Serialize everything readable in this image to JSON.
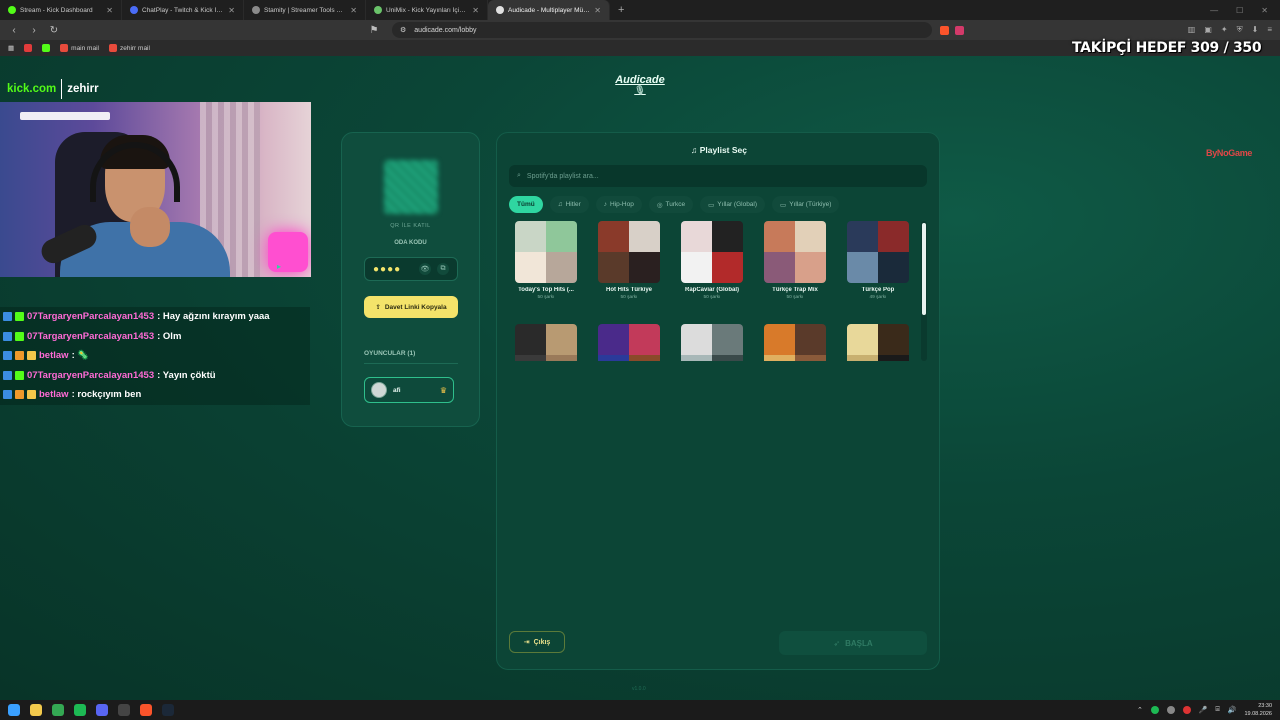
{
  "browser": {
    "tabs": [
      {
        "title": "Stream - Kick Dashboard",
        "color": "#53fc18"
      },
      {
        "title": "ChatPlay - Twitch & Kick İzleyici Etkil",
        "color": "#4a6cf7"
      },
      {
        "title": "Stamity | Streamer Tools & Party Gam",
        "color": "#8a8a8a"
      },
      {
        "title": "UniMix - Kick Yayınları İçin Kelime Ba",
        "color": "#6ac36a"
      },
      {
        "title": "Audicade - Multiplayer Müzik Ta",
        "color": "#e1e1e1"
      }
    ],
    "url": "audicade.com/lobby",
    "bookmarks": [
      {
        "label": "",
        "color": "#e23b3b"
      },
      {
        "label": "",
        "color": "#53fc18"
      },
      {
        "label": "main mail",
        "color": "#e84b3c"
      },
      {
        "label": "zehirr mail",
        "color": "#e84b3c"
      }
    ]
  },
  "overlay": {
    "target_text": "TAKİPÇİ HEDEF 309 / 350",
    "kick_site": "kick.com",
    "kick_user": "zehirr",
    "watermark": "ByNoGame"
  },
  "app": {
    "logo": "Audicade",
    "lobby": {
      "qr_label": "QR İLE KATIL",
      "room_code_label": "ODA KODU",
      "room_code_masked": "●●●●",
      "invite_button": "Davet Linki Kopyala",
      "players_title": "OYUNCULAR (1)",
      "players": [
        {
          "name": "afi"
        }
      ]
    },
    "playlist": {
      "title": "Playlist Seç",
      "search_placeholder": "Spotify'da playlist ara...",
      "filters": [
        {
          "label": "Tümü",
          "active": true,
          "icon": ""
        },
        {
          "label": "Hitler",
          "active": false,
          "icon": "♫"
        },
        {
          "label": "Hip-Hop",
          "active": false,
          "icon": "♪"
        },
        {
          "label": "Turkce",
          "active": false,
          "icon": "◎"
        },
        {
          "label": "Yıllar (Global)",
          "active": false,
          "icon": "▭"
        },
        {
          "label": "Yıllar (Türkiye)",
          "active": false,
          "icon": "▭"
        }
      ],
      "items": [
        {
          "name": "Today's Top Hits (...",
          "count": "50 şarkı",
          "colors": [
            "#c9d6c6",
            "#8fc79a",
            "#f1e6d8",
            "#b7a79a"
          ]
        },
        {
          "name": "Hot Hits Türkiye",
          "count": "50 şarkı",
          "colors": [
            "#8a3a2a",
            "#d8d0c8",
            "#5a3a2a",
            "#2a2020"
          ]
        },
        {
          "name": "RapCaviar (Global)",
          "count": "50 şarkı",
          "colors": [
            "#e8d8d8",
            "#222222",
            "#f2f2f2",
            "#b22a2a"
          ]
        },
        {
          "name": "Türkçe Trap Mix",
          "count": "50 şarkı",
          "colors": [
            "#c77a5a",
            "#e2d0b8",
            "#8a5a78",
            "#d8a08a"
          ]
        },
        {
          "name": "Türkçe Pop",
          "count": "49 şarkı",
          "colors": [
            "#2a3a5a",
            "#8a2a2a",
            "#6a8aa8",
            "#1a2a3a"
          ]
        },
        {
          "name": "",
          "count": "",
          "colors": [
            "#2a2a2a",
            "#b89a72",
            "#3a3a3a",
            "#9a7a5a"
          ]
        },
        {
          "name": "",
          "count": "",
          "colors": [
            "#4a2a8a",
            "#c23a5a",
            "#2a3a9a",
            "#8a4a2a"
          ]
        },
        {
          "name": "",
          "count": "",
          "colors": [
            "#dcdcdc",
            "#6a7a7a",
            "#a8b8b8",
            "#3a4a4a"
          ]
        },
        {
          "name": "",
          "count": "",
          "colors": [
            "#d87a2a",
            "#5a3a2a",
            "#e0b060",
            "#8a5a3a"
          ]
        },
        {
          "name": "",
          "count": "",
          "colors": [
            "#e8d89a",
            "#3a2a1a",
            "#c8b070",
            "#1a1a1a"
          ]
        }
      ],
      "exit_button": "Çıkış",
      "start_button": "BAŞLA"
    }
  },
  "chat": [
    {
      "user": "07TargaryenParcalayan1453",
      "message": ": Hay ağzını kırayım yaaa",
      "badges": [
        "b-blue",
        "b-green"
      ]
    },
    {
      "user": "07TargaryenParcalayan1453",
      "message": ": Olm",
      "badges": [
        "b-blue",
        "b-green"
      ]
    },
    {
      "user": "betlaw",
      "message": ": 🦠",
      "badges": [
        "b-blue",
        "b-orange",
        "b-crown"
      ]
    },
    {
      "user": "07TargaryenParcalayan1453",
      "message": ": Yayın çöktü",
      "badges": [
        "b-blue",
        "b-green"
      ]
    },
    {
      "user": "betlaw",
      "message": ": rockçıyım ben",
      "badges": [
        "b-blue",
        "b-orange",
        "b-crown"
      ]
    }
  ],
  "taskbar": {
    "apps": [
      {
        "name": "windows-start",
        "color": "#3aa0ff"
      },
      {
        "name": "file-explorer",
        "color": "#f2c94c"
      },
      {
        "name": "chrome",
        "color": "#34a853"
      },
      {
        "name": "spotify",
        "color": "#1db954"
      },
      {
        "name": "discord",
        "color": "#5865f2"
      },
      {
        "name": "obs",
        "color": "#444444"
      },
      {
        "name": "brave",
        "color": "#fb542b"
      },
      {
        "name": "steam",
        "color": "#1b2838"
      }
    ],
    "time": "23:30",
    "date": "19.08.2026"
  }
}
